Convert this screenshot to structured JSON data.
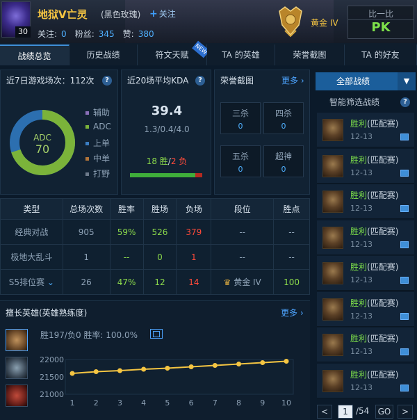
{
  "header": {
    "level": "30",
    "player_name": "地狱V亡灵",
    "server": "(黑色玫瑰)",
    "follow_label": "关注",
    "stats": {
      "follow_label": "关注:",
      "follow_value": "0",
      "fans_label": "粉丝:",
      "fans_value": "345",
      "likes_label": "赞:",
      "likes_value": "380"
    },
    "rank_label": "黄金 IV",
    "compare_title": "比一比",
    "compare_pk": "PK"
  },
  "tabs": [
    {
      "label": "战绩总览",
      "active": true
    },
    {
      "label": "历史战绩"
    },
    {
      "label": "符文天赋",
      "badge": "NEW"
    },
    {
      "label": "TA 的英雄"
    },
    {
      "label": "荣誉截图"
    },
    {
      "label": "TA 的好友"
    }
  ],
  "recent_games": {
    "title": "近7日游戏场次：112次",
    "donut_label": "ADC",
    "donut_value": "70",
    "legend": [
      {
        "label": "辅助",
        "color": "#8a6fb8"
      },
      {
        "label": "ADC",
        "color": "#7bb33a"
      },
      {
        "label": "上单",
        "color": "#3b7ec2"
      },
      {
        "label": "中单",
        "color": "#b3753a"
      },
      {
        "label": "打野",
        "color": "#6e7b8c"
      }
    ],
    "chart_data": {
      "type": "pie",
      "values": [
        {
          "label": "ADC",
          "value": 70
        },
        {
          "label": "上单",
          "value": 30
        }
      ]
    }
  },
  "kda": {
    "title": "近20场平均KDA",
    "value": "39.4",
    "breakdown": "1.3/0.4/4.0",
    "wins": "18 胜",
    "separator": "/",
    "losses": "2 负",
    "win_fraction": 0.9
  },
  "honor": {
    "title": "荣誉截图",
    "more": "更多",
    "boxes": [
      {
        "name": "三杀",
        "value": "0"
      },
      {
        "name": "四杀",
        "value": "0"
      },
      {
        "name": "五杀",
        "value": "0"
      },
      {
        "name": "超神",
        "value": "0"
      }
    ]
  },
  "table": {
    "headers": [
      "类型",
      "总场次数",
      "胜率",
      "胜场",
      "负场",
      "段位",
      "胜点"
    ],
    "rows": [
      {
        "type": "经典对战",
        "total": "905",
        "rate": "59%",
        "wins": "526",
        "losses": "379",
        "tier": "--",
        "points": "--"
      },
      {
        "type": "极地大乱斗",
        "total": "1",
        "rate": "--",
        "wins": "0",
        "losses": "1",
        "tier": "--",
        "points": "--"
      },
      {
        "type": "S5排位赛",
        "total": "26",
        "rate": "47%",
        "wins": "12",
        "losses": "14",
        "tier": "黄金 IV",
        "points": "100"
      }
    ]
  },
  "heroes": {
    "title": "擅长英雄(英雄熟练度)",
    "more": "更多",
    "stats": "胜197/负0   胜率: 100.0%",
    "chart_data": {
      "type": "line",
      "x": [
        1,
        2,
        3,
        4,
        5,
        6,
        7,
        8,
        9,
        10
      ],
      "series": [
        {
          "values": [
            21600,
            21650,
            21680,
            21720,
            21750,
            21790,
            21830,
            21870,
            21910,
            21950
          ]
        }
      ],
      "ylim": [
        21000,
        22000
      ],
      "yticks": [
        "22000",
        "21500",
        "21000"
      ],
      "xticks": [
        "1",
        "2",
        "3",
        "4",
        "5",
        "6",
        "7",
        "8",
        "9",
        "10"
      ]
    }
  },
  "sidebar": {
    "all_records": "全部战绩",
    "smart_filter": "智能筛选战绩",
    "matches": [
      {
        "result": "胜利",
        "mode": "(匹配赛)",
        "date": "12-13"
      },
      {
        "result": "胜利",
        "mode": "(匹配赛)",
        "date": "12-13"
      },
      {
        "result": "胜利",
        "mode": "(匹配赛)",
        "date": "12-13"
      },
      {
        "result": "胜利",
        "mode": "(匹配赛)",
        "date": "12-13"
      },
      {
        "result": "胜利",
        "mode": "(匹配赛)",
        "date": "12-13"
      },
      {
        "result": "胜利",
        "mode": "(匹配赛)",
        "date": "12-13"
      },
      {
        "result": "胜利",
        "mode": "(匹配赛)",
        "date": "12-13"
      },
      {
        "result": "胜利",
        "mode": "(匹配赛)",
        "date": "12-13"
      }
    ]
  },
  "pager": {
    "prev": "<",
    "current": "1",
    "total": "/54",
    "go": "GO",
    "next": ">"
  }
}
